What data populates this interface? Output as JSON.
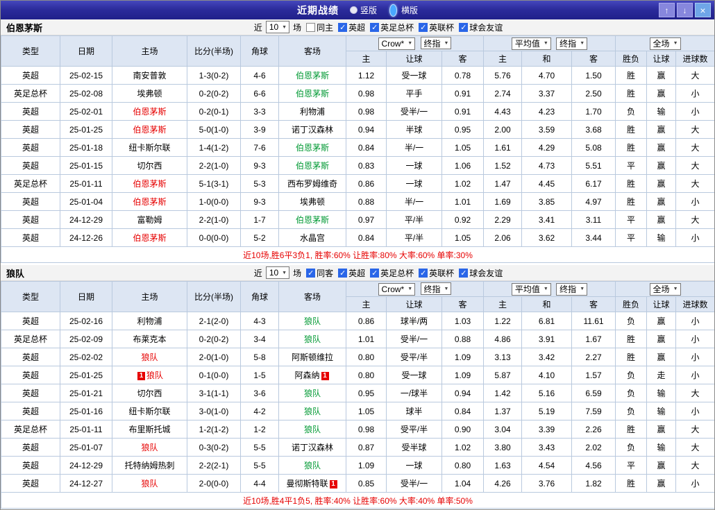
{
  "titlebar": {
    "title": "近期战绩",
    "layout_options": {
      "vertical": "竖版",
      "horizontal": "横版",
      "selected": "横版"
    },
    "window_buttons": {
      "up": "↑",
      "down": "↓",
      "close": "×"
    }
  },
  "filter_labels": {
    "near": "近",
    "games": "场"
  },
  "header": {
    "type": "类型",
    "date": "日期",
    "home": "主场",
    "score": "比分(半场)",
    "corner": "角球",
    "away": "客场",
    "odds_source": "Crow*",
    "odds_index": "终指",
    "avg_source": "平均值",
    "avg_index": "终指",
    "scope": "全场",
    "sub_home": "主",
    "sub_handicap": "让球",
    "sub_away": "客",
    "sub_h": "主",
    "sub_draw": "和",
    "sub_a": "客",
    "wdl": "胜负",
    "handicap_result": "让球",
    "goals": "进球数"
  },
  "colors": {
    "league_red": "#e60000",
    "league_blue": "#1212cc",
    "win_red": "#e60000",
    "draw_blue": "#0044cc",
    "loss_green": "#009933"
  },
  "sections": [
    {
      "team": "伯恩茅斯",
      "match_count": "10",
      "same_venue": {
        "label": "同主",
        "checked": false
      },
      "leagues": [
        {
          "label": "英超",
          "checked": true
        },
        {
          "label": "英足总杯",
          "checked": true
        },
        {
          "label": "英联杯",
          "checked": true
        },
        {
          "label": "球会友谊",
          "checked": true
        }
      ],
      "rows": [
        {
          "league": "英超",
          "league_color": "red",
          "date": "25-02-15",
          "home": "南安普敦",
          "score": "1-3(0-2)",
          "result": "win",
          "corner": "4-6",
          "away": "伯恩茅斯",
          "odds": [
            "1.12",
            "受一球",
            "0.78"
          ],
          "avg": [
            "5.76",
            "4.70",
            "1.50"
          ],
          "wdl": "胜",
          "handicap": "赢",
          "goals": "大"
        },
        {
          "league": "英足总杯",
          "league_color": "blue",
          "date": "25-02-08",
          "home": "埃弗顿",
          "score": "0-2(0-2)",
          "result": "win",
          "corner": "6-6",
          "away": "伯恩茅斯",
          "odds": [
            "0.98",
            "平手",
            "0.91"
          ],
          "avg": [
            "2.74",
            "3.37",
            "2.50"
          ],
          "wdl": "胜",
          "handicap": "赢",
          "goals": "小"
        },
        {
          "league": "英超",
          "league_color": "red",
          "date": "25-02-01",
          "home": "伯恩茅斯",
          "score": "0-2(0-1)",
          "result": "loss",
          "corner": "3-3",
          "away": "利物浦",
          "odds": [
            "0.98",
            "受半/一",
            "0.91"
          ],
          "avg": [
            "4.43",
            "4.23",
            "1.70"
          ],
          "wdl": "负",
          "handicap": "输",
          "goals": "小"
        },
        {
          "league": "英超",
          "league_color": "red",
          "date": "25-01-25",
          "home": "伯恩茅斯",
          "score": "5-0(1-0)",
          "result": "win",
          "corner": "3-9",
          "away": "诺丁汉森林",
          "odds": [
            "0.94",
            "半球",
            "0.95"
          ],
          "avg": [
            "2.00",
            "3.59",
            "3.68"
          ],
          "wdl": "胜",
          "handicap": "赢",
          "goals": "大"
        },
        {
          "league": "英超",
          "league_color": "red",
          "date": "25-01-18",
          "home": "纽卡斯尔联",
          "score": "1-4(1-2)",
          "result": "win",
          "corner": "7-6",
          "away": "伯恩茅斯",
          "odds": [
            "0.84",
            "半/一",
            "1.05"
          ],
          "avg": [
            "1.61",
            "4.29",
            "5.08"
          ],
          "wdl": "胜",
          "handicap": "赢",
          "goals": "大"
        },
        {
          "league": "英超",
          "league_color": "red",
          "date": "25-01-15",
          "home": "切尔西",
          "score": "2-2(1-0)",
          "result": "draw",
          "corner": "9-3",
          "away": "伯恩茅斯",
          "odds": [
            "0.83",
            "一球",
            "1.06"
          ],
          "avg": [
            "1.52",
            "4.73",
            "5.51"
          ],
          "wdl": "平",
          "handicap": "赢",
          "goals": "大"
        },
        {
          "league": "英足总杯",
          "league_color": "blue",
          "date": "25-01-11",
          "home": "伯恩茅斯",
          "score": "5-1(3-1)",
          "result": "win",
          "corner": "5-3",
          "away": "西布罗姆维奇",
          "odds": [
            "0.86",
            "一球",
            "1.02"
          ],
          "avg": [
            "1.47",
            "4.45",
            "6.17"
          ],
          "wdl": "胜",
          "handicap": "赢",
          "goals": "大"
        },
        {
          "league": "英超",
          "league_color": "red",
          "date": "25-01-04",
          "home": "伯恩茅斯",
          "score": "1-0(0-0)",
          "result": "win",
          "corner": "9-3",
          "away": "埃弗顿",
          "odds": [
            "0.88",
            "半/一",
            "1.01"
          ],
          "avg": [
            "1.69",
            "3.85",
            "4.97"
          ],
          "wdl": "胜",
          "handicap": "赢",
          "goals": "小"
        },
        {
          "league": "英超",
          "league_color": "red",
          "date": "24-12-29",
          "home": "富勒姆",
          "score": "2-2(1-0)",
          "result": "draw",
          "corner": "1-7",
          "away": "伯恩茅斯",
          "odds": [
            "0.97",
            "平/半",
            "0.92"
          ],
          "avg": [
            "2.29",
            "3.41",
            "3.11"
          ],
          "wdl": "平",
          "handicap": "赢",
          "goals": "大"
        },
        {
          "league": "英超",
          "league_color": "red",
          "date": "24-12-26",
          "home": "伯恩茅斯",
          "score": "0-0(0-0)",
          "result": "draw",
          "corner": "5-2",
          "away": "水晶宫",
          "odds": [
            "0.84",
            "平/半",
            "1.05"
          ],
          "avg": [
            "2.06",
            "3.62",
            "3.44"
          ],
          "wdl": "平",
          "handicap": "输",
          "goals": "小"
        }
      ],
      "summary": "近10场,胜6平3负1, 胜率:60% 让胜率:80% 大率:60% 单率:30%"
    },
    {
      "team": "狼队",
      "match_count": "10",
      "same_venue": {
        "label": "同客",
        "checked": true
      },
      "leagues": [
        {
          "label": "英超",
          "checked": true
        },
        {
          "label": "英足总杯",
          "checked": true
        },
        {
          "label": "英联杯",
          "checked": true
        },
        {
          "label": "球会友谊",
          "checked": true
        }
      ],
      "rows": [
        {
          "league": "英超",
          "league_color": "red",
          "date": "25-02-16",
          "home": "利物浦",
          "score": "2-1(2-0)",
          "result": "loss",
          "corner": "4-3",
          "away": "狼队",
          "odds": [
            "0.86",
            "球半/两",
            "1.03"
          ],
          "avg": [
            "1.22",
            "6.81",
            "11.61"
          ],
          "wdl": "负",
          "handicap": "赢",
          "goals": "小"
        },
        {
          "league": "英足总杯",
          "league_color": "blue",
          "date": "25-02-09",
          "home": "布莱克本",
          "score": "0-2(0-2)",
          "result": "win",
          "corner": "3-4",
          "away": "狼队",
          "odds": [
            "1.01",
            "受半/一",
            "0.88"
          ],
          "avg": [
            "4.86",
            "3.91",
            "1.67"
          ],
          "wdl": "胜",
          "handicap": "赢",
          "goals": "小"
        },
        {
          "league": "英超",
          "league_color": "red",
          "date": "25-02-02",
          "home": "狼队",
          "score": "2-0(1-0)",
          "result": "win",
          "corner": "5-8",
          "away": "阿斯顿维拉",
          "odds": [
            "0.80",
            "受平/半",
            "1.09"
          ],
          "avg": [
            "3.13",
            "3.42",
            "2.27"
          ],
          "wdl": "胜",
          "handicap": "赢",
          "goals": "小"
        },
        {
          "league": "英超",
          "league_color": "red",
          "date": "25-01-25",
          "home": "狼队",
          "home_card": "1",
          "score": "0-1(0-0)",
          "result": "loss",
          "corner": "1-5",
          "away": "阿森纳",
          "away_card": "1",
          "odds": [
            "0.80",
            "受一球",
            "1.09"
          ],
          "avg": [
            "5.87",
            "4.10",
            "1.57"
          ],
          "wdl": "负",
          "handicap": "走",
          "goals": "小"
        },
        {
          "league": "英超",
          "league_color": "red",
          "date": "25-01-21",
          "home": "切尔西",
          "score": "3-1(1-1)",
          "result": "loss",
          "corner": "3-6",
          "away": "狼队",
          "odds": [
            "0.95",
            "一/球半",
            "0.94"
          ],
          "avg": [
            "1.42",
            "5.16",
            "6.59"
          ],
          "wdl": "负",
          "handicap": "输",
          "goals": "大"
        },
        {
          "league": "英超",
          "league_color": "red",
          "date": "25-01-16",
          "home": "纽卡斯尔联",
          "score": "3-0(1-0)",
          "result": "loss",
          "corner": "4-2",
          "away": "狼队",
          "odds": [
            "1.05",
            "球半",
            "0.84"
          ],
          "avg": [
            "1.37",
            "5.19",
            "7.59"
          ],
          "wdl": "负",
          "handicap": "输",
          "goals": "小"
        },
        {
          "league": "英足总杯",
          "league_color": "blue",
          "date": "25-01-11",
          "home": "布里斯托城",
          "score": "1-2(1-2)",
          "result": "win",
          "corner": "1-2",
          "away": "狼队",
          "odds": [
            "0.98",
            "受平/半",
            "0.90"
          ],
          "avg": [
            "3.04",
            "3.39",
            "2.26"
          ],
          "wdl": "胜",
          "handicap": "赢",
          "goals": "大"
        },
        {
          "league": "英超",
          "league_color": "red",
          "date": "25-01-07",
          "home": "狼队",
          "score": "0-3(0-2)",
          "result": "loss",
          "corner": "5-5",
          "away": "诺丁汉森林",
          "odds": [
            "0.87",
            "受半球",
            "1.02"
          ],
          "avg": [
            "3.80",
            "3.43",
            "2.02"
          ],
          "wdl": "负",
          "handicap": "输",
          "goals": "大"
        },
        {
          "league": "英超",
          "league_color": "red",
          "date": "24-12-29",
          "home": "托特纳姆热刺",
          "score": "2-2(2-1)",
          "result": "draw",
          "corner": "5-5",
          "away": "狼队",
          "odds": [
            "1.09",
            "一球",
            "0.80"
          ],
          "avg": [
            "1.63",
            "4.54",
            "4.56"
          ],
          "wdl": "平",
          "handicap": "赢",
          "goals": "大"
        },
        {
          "league": "英超",
          "league_color": "red",
          "date": "24-12-27",
          "home": "狼队",
          "score": "2-0(0-0)",
          "result": "win",
          "corner": "4-4",
          "away": "曼彻斯特联",
          "away_card": "1",
          "odds": [
            "0.85",
            "受半/一",
            "1.04"
          ],
          "avg": [
            "4.26",
            "3.76",
            "1.82"
          ],
          "wdl": "胜",
          "handicap": "赢",
          "goals": "小"
        }
      ],
      "summary": "近10场,胜4平1负5, 胜率:40% 让胜率:60% 大率:40% 单率:50%"
    }
  ]
}
